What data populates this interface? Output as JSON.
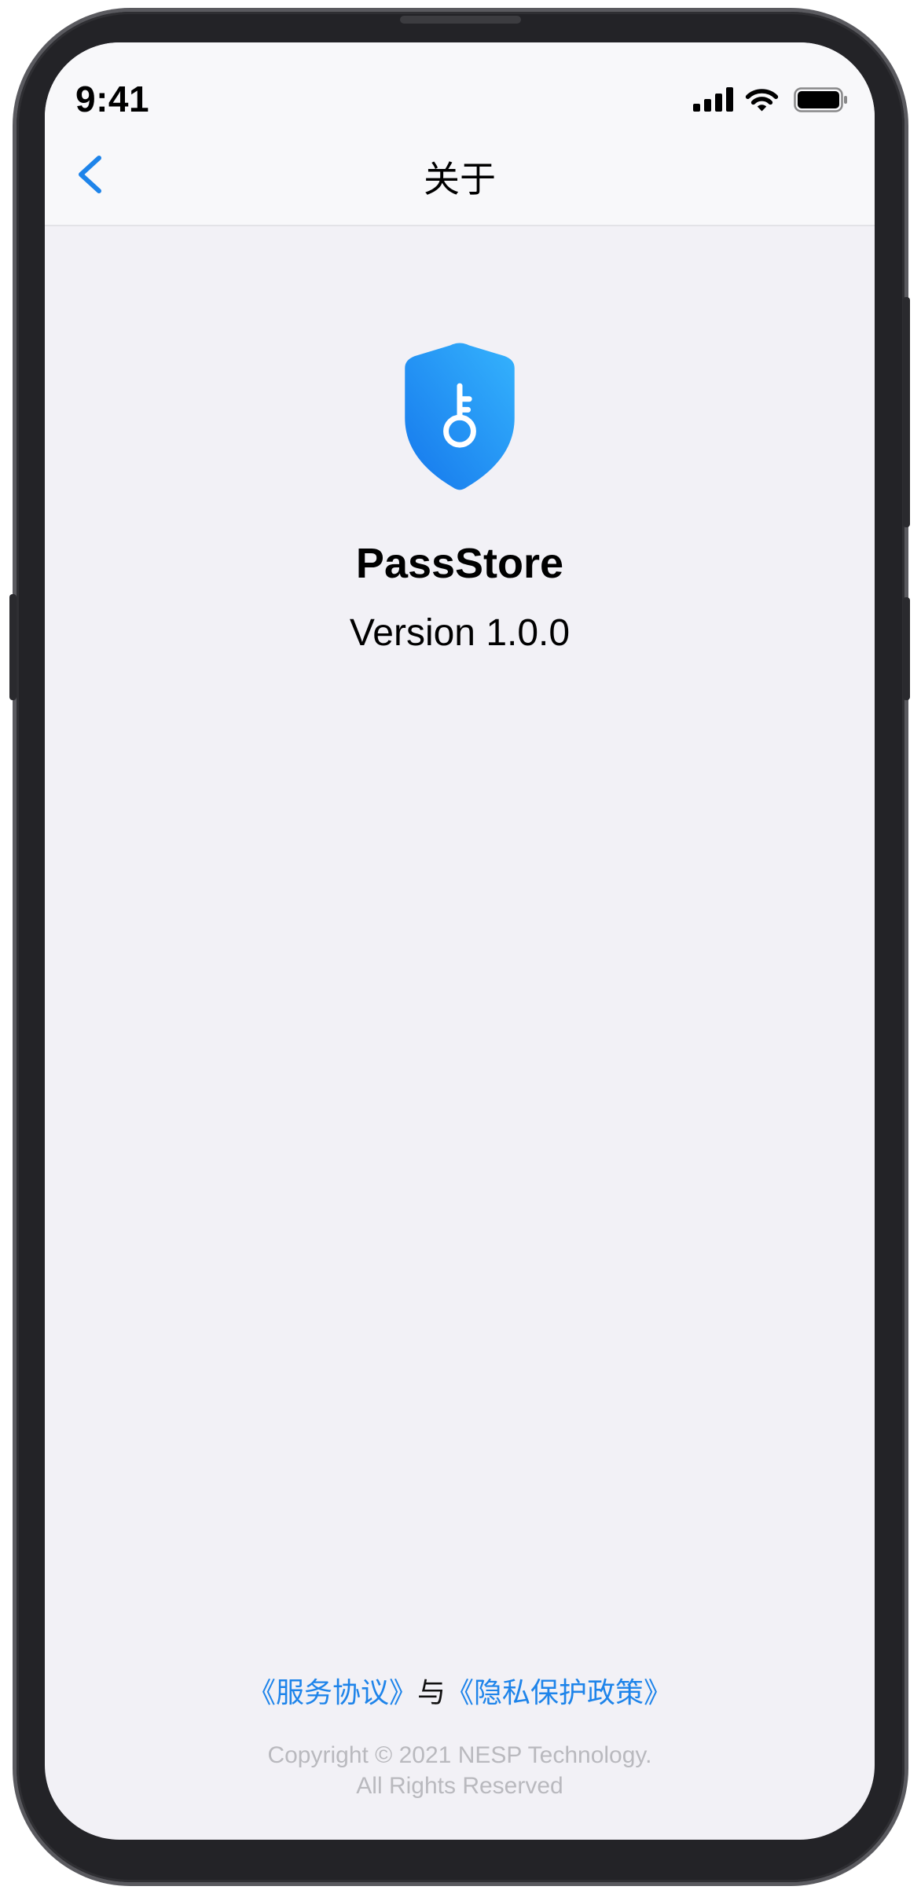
{
  "status_bar": {
    "time": "9:41",
    "signal_bars": 4,
    "battery_level": 1.0
  },
  "nav": {
    "title": "关于"
  },
  "app": {
    "name": "PassStore",
    "version": "Version 1.0.0"
  },
  "footer": {
    "terms_link": "《服务协议》",
    "connector": "与",
    "privacy_link": "《隐私保护政策》",
    "copyright_line1": "Copyright © 2021 NESP Technology.",
    "copyright_line2": "All Rights Reserved"
  },
  "icons": {
    "back": "chevron-left-icon",
    "logo": "shield-key-icon",
    "signal": "cellular-signal-icon",
    "wifi": "wifi-icon",
    "battery": "battery-icon"
  },
  "colors": {
    "accent": "#1e84ea",
    "screen_background": "#f2f1f6",
    "nav_background": "#f8f8fa",
    "muted_text": "#b9b9be",
    "logo_gradient_start": "#35b3fd",
    "logo_gradient_end": "#1577ec"
  }
}
